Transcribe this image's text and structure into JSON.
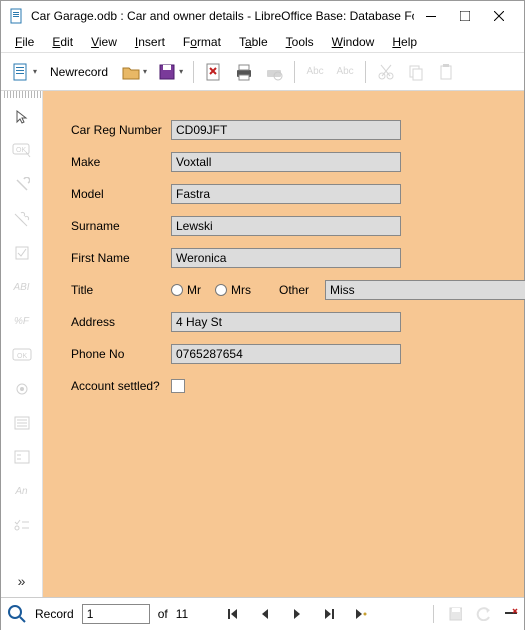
{
  "titlebar": {
    "title": "Car Garage.odb : Car and owner details - LibreOffice Base: Database Form"
  },
  "menu": {
    "file": "File",
    "edit": "Edit",
    "view": "View",
    "insert": "Insert",
    "format": "Format",
    "table": "Table",
    "tools": "Tools",
    "window": "Window",
    "help": "Help"
  },
  "toolbar": {
    "newrecord": "Newrecord",
    "abc1": "Abc",
    "abc2": "Abc"
  },
  "form": {
    "labels": {
      "reg": "Car Reg Number",
      "make": "Make",
      "model": "Model",
      "surname": "Surname",
      "firstname": "First Name",
      "title": "Title",
      "address": "Address",
      "phone": "Phone No",
      "settled": "Account settled?",
      "mr": "Mr",
      "mrs": "Mrs",
      "other": "Other"
    },
    "values": {
      "reg": "CD09JFT",
      "make": "Voxtall",
      "model": "Fastra",
      "surname": "Lewski",
      "firstname": "Weronica",
      "other_title": "Miss",
      "address": "4 Hay St",
      "phone": "0765287654"
    }
  },
  "nav": {
    "record_label": "Record",
    "current": "1",
    "of": "of",
    "total": "11"
  },
  "side": {
    "an": "An",
    "pf": "%F",
    "abi": "ABI",
    "ok": "OK"
  }
}
